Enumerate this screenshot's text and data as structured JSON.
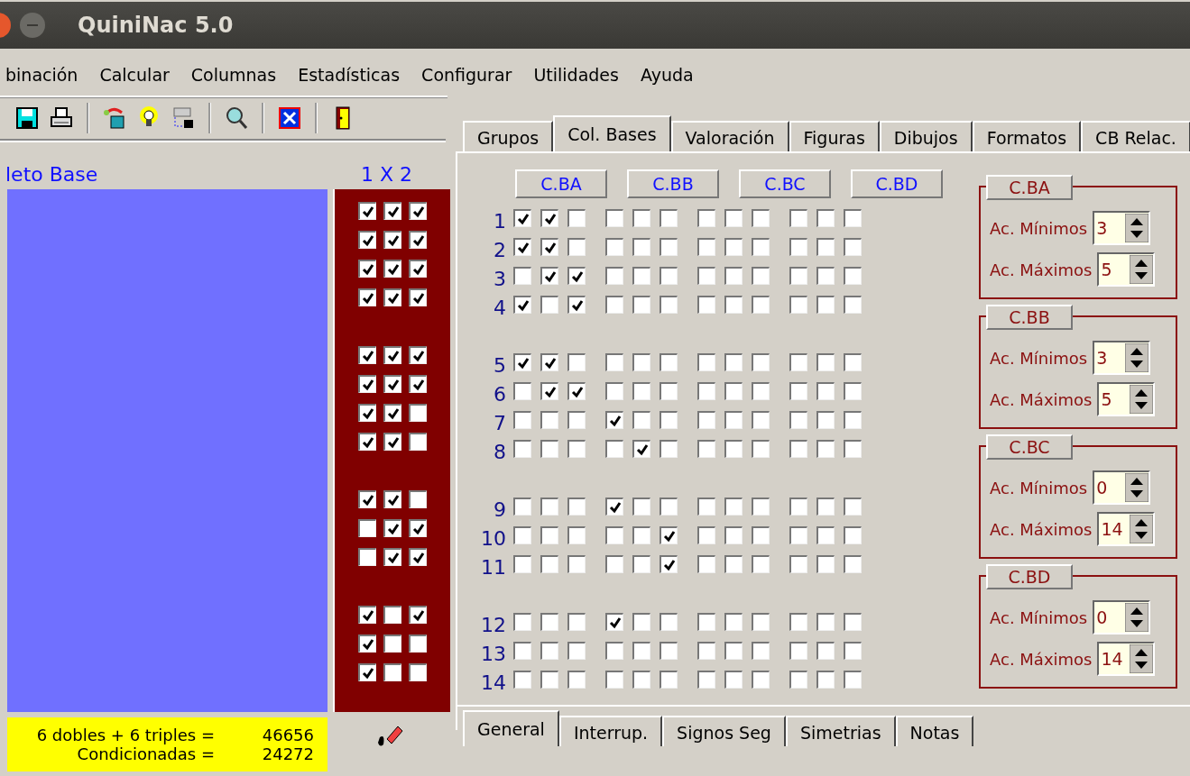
{
  "window": {
    "title": "QuiniNac 5.0"
  },
  "menu": [
    "binación",
    "Calcular",
    "Columnas",
    "Estadísticas",
    "Configurar",
    "Utilidades",
    "Ayuda"
  ],
  "left_panel": {
    "label": "leto Base",
    "signs_label": "1 X 2"
  },
  "top_tabs": [
    {
      "label": "Grupos",
      "selected": false
    },
    {
      "label": "Col. Bases",
      "selected": true
    },
    {
      "label": "Valoración",
      "selected": false
    },
    {
      "label": "Figuras",
      "selected": false
    },
    {
      "label": "Dibujos",
      "selected": false
    },
    {
      "label": "Formatos",
      "selected": false
    },
    {
      "label": "CB Relac.",
      "selected": false
    }
  ],
  "base_columns": [
    "C.BA",
    "C.BB",
    "C.BC",
    "C.BD"
  ],
  "groups": [
    {
      "rows": [
        {
          "number": "1",
          "signs": [
            true,
            true,
            true
          ],
          "bases": [
            [
              true,
              true,
              false
            ],
            [
              false,
              false,
              false
            ],
            [
              false,
              false,
              false
            ],
            [
              false,
              false,
              false
            ]
          ]
        },
        {
          "number": "2",
          "signs": [
            true,
            true,
            true
          ],
          "bases": [
            [
              true,
              true,
              false
            ],
            [
              false,
              false,
              false
            ],
            [
              false,
              false,
              false
            ],
            [
              false,
              false,
              false
            ]
          ]
        },
        {
          "number": "3",
          "signs": [
            true,
            true,
            true
          ],
          "bases": [
            [
              false,
              true,
              true
            ],
            [
              false,
              false,
              false
            ],
            [
              false,
              false,
              false
            ],
            [
              false,
              false,
              false
            ]
          ]
        },
        {
          "number": "4",
          "signs": [
            true,
            true,
            true
          ],
          "bases": [
            [
              true,
              false,
              true
            ],
            [
              false,
              false,
              false
            ],
            [
              false,
              false,
              false
            ],
            [
              false,
              false,
              false
            ]
          ]
        }
      ]
    },
    {
      "rows": [
        {
          "number": "5",
          "signs": [
            true,
            true,
            true
          ],
          "bases": [
            [
              true,
              true,
              false
            ],
            [
              false,
              false,
              false
            ],
            [
              false,
              false,
              false
            ],
            [
              false,
              false,
              false
            ]
          ]
        },
        {
          "number": "6",
          "signs": [
            true,
            true,
            true
          ],
          "bases": [
            [
              false,
              true,
              true
            ],
            [
              false,
              false,
              false
            ],
            [
              false,
              false,
              false
            ],
            [
              false,
              false,
              false
            ]
          ]
        },
        {
          "number": "7",
          "signs": [
            true,
            true,
            false
          ],
          "bases": [
            [
              false,
              false,
              false
            ],
            [
              true,
              false,
              false
            ],
            [
              false,
              false,
              false
            ],
            [
              false,
              false,
              false
            ]
          ]
        },
        {
          "number": "8",
          "signs": [
            true,
            true,
            false
          ],
          "bases": [
            [
              false,
              false,
              false
            ],
            [
              false,
              true,
              false
            ],
            [
              false,
              false,
              false
            ],
            [
              false,
              false,
              false
            ]
          ]
        }
      ]
    },
    {
      "rows": [
        {
          "number": "9",
          "signs": [
            true,
            true,
            false
          ],
          "bases": [
            [
              false,
              false,
              false
            ],
            [
              true,
              false,
              false
            ],
            [
              false,
              false,
              false
            ],
            [
              false,
              false,
              false
            ]
          ]
        },
        {
          "number": "10",
          "signs": [
            false,
            true,
            true
          ],
          "bases": [
            [
              false,
              false,
              false
            ],
            [
              false,
              false,
              true
            ],
            [
              false,
              false,
              false
            ],
            [
              false,
              false,
              false
            ]
          ]
        },
        {
          "number": "11",
          "signs": [
            false,
            true,
            true
          ],
          "bases": [
            [
              false,
              false,
              false
            ],
            [
              false,
              false,
              true
            ],
            [
              false,
              false,
              false
            ],
            [
              false,
              false,
              false
            ]
          ]
        }
      ]
    },
    {
      "rows": [
        {
          "number": "12",
          "signs": [
            true,
            false,
            true
          ],
          "bases": [
            [
              false,
              false,
              false
            ],
            [
              true,
              false,
              false
            ],
            [
              false,
              false,
              false
            ],
            [
              false,
              false,
              false
            ]
          ]
        },
        {
          "number": "13",
          "signs": [
            true,
            false,
            false
          ],
          "bases": [
            [
              false,
              false,
              false
            ],
            [
              false,
              false,
              false
            ],
            [
              false,
              false,
              false
            ],
            [
              false,
              false,
              false
            ]
          ]
        },
        {
          "number": "14",
          "signs": [
            true,
            false,
            false
          ],
          "bases": [
            [
              false,
              false,
              false
            ],
            [
              false,
              false,
              false
            ],
            [
              false,
              false,
              false
            ],
            [
              false,
              false,
              false
            ]
          ]
        }
      ]
    }
  ],
  "limits": [
    {
      "title": "C.BA",
      "min_label": "Ac. Mínimos",
      "min": "3",
      "max_label": "Ac. Máximos",
      "max": "5"
    },
    {
      "title": "C.BB",
      "min_label": "Ac. Mínimos",
      "min": "3",
      "max_label": "Ac. Máximos",
      "max": "5"
    },
    {
      "title": "C.BC",
      "min_label": "Ac. Mínimos",
      "min": "0",
      "max_label": "Ac. Máximos",
      "max": "14"
    },
    {
      "title": "C.BD",
      "min_label": "Ac. Mínimos",
      "min": "0",
      "max_label": "Ac. Máximos",
      "max": "14"
    }
  ],
  "summary": [
    {
      "label": "6 dobles + 6 triples =",
      "value": "46656"
    },
    {
      "label": "Condicionadas =",
      "value": "24272"
    }
  ],
  "bottom_tabs": [
    {
      "label": "General",
      "selected": true
    },
    {
      "label": "Interrup.",
      "selected": false
    },
    {
      "label": "Signos Seg",
      "selected": false
    },
    {
      "label": "Simetrias",
      "selected": false
    },
    {
      "label": "Notas",
      "selected": false
    }
  ]
}
